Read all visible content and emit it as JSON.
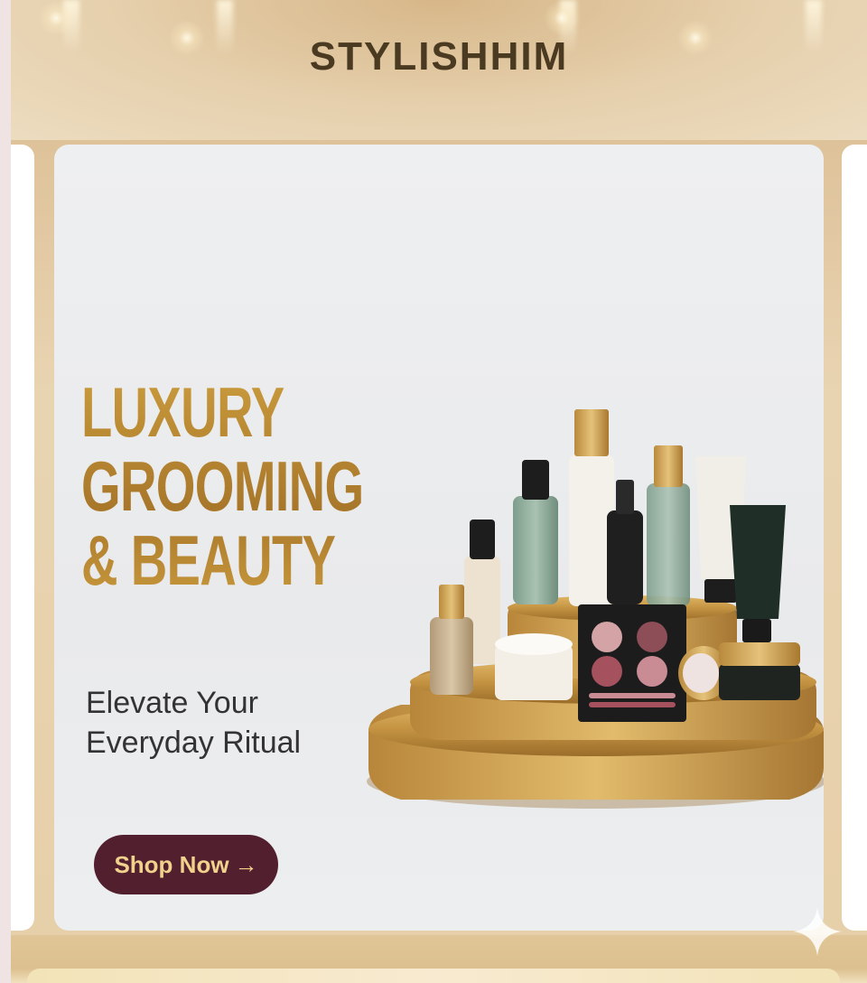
{
  "header": {
    "brand": "STYLISHHIM"
  },
  "hero_slide": {
    "headline_lines": [
      "LUXURY",
      "GROOMING",
      "& BEAUTY"
    ],
    "subtitle_lines": [
      "Elevate Your",
      "Everyday Ritual"
    ],
    "cta_label": "Shop Now",
    "cta_arrow": "→",
    "product_image": "luxury-cosmetics-display-icon"
  },
  "colors": {
    "brand_text": "#4b3a22",
    "headline_gold": "#b8862c",
    "cta_background": "#521f2f",
    "cta_text": "#f1d28d",
    "page_gold": "#e6cfa8"
  },
  "icons": {
    "corner_sparkle": "sparkle-star-icon"
  }
}
